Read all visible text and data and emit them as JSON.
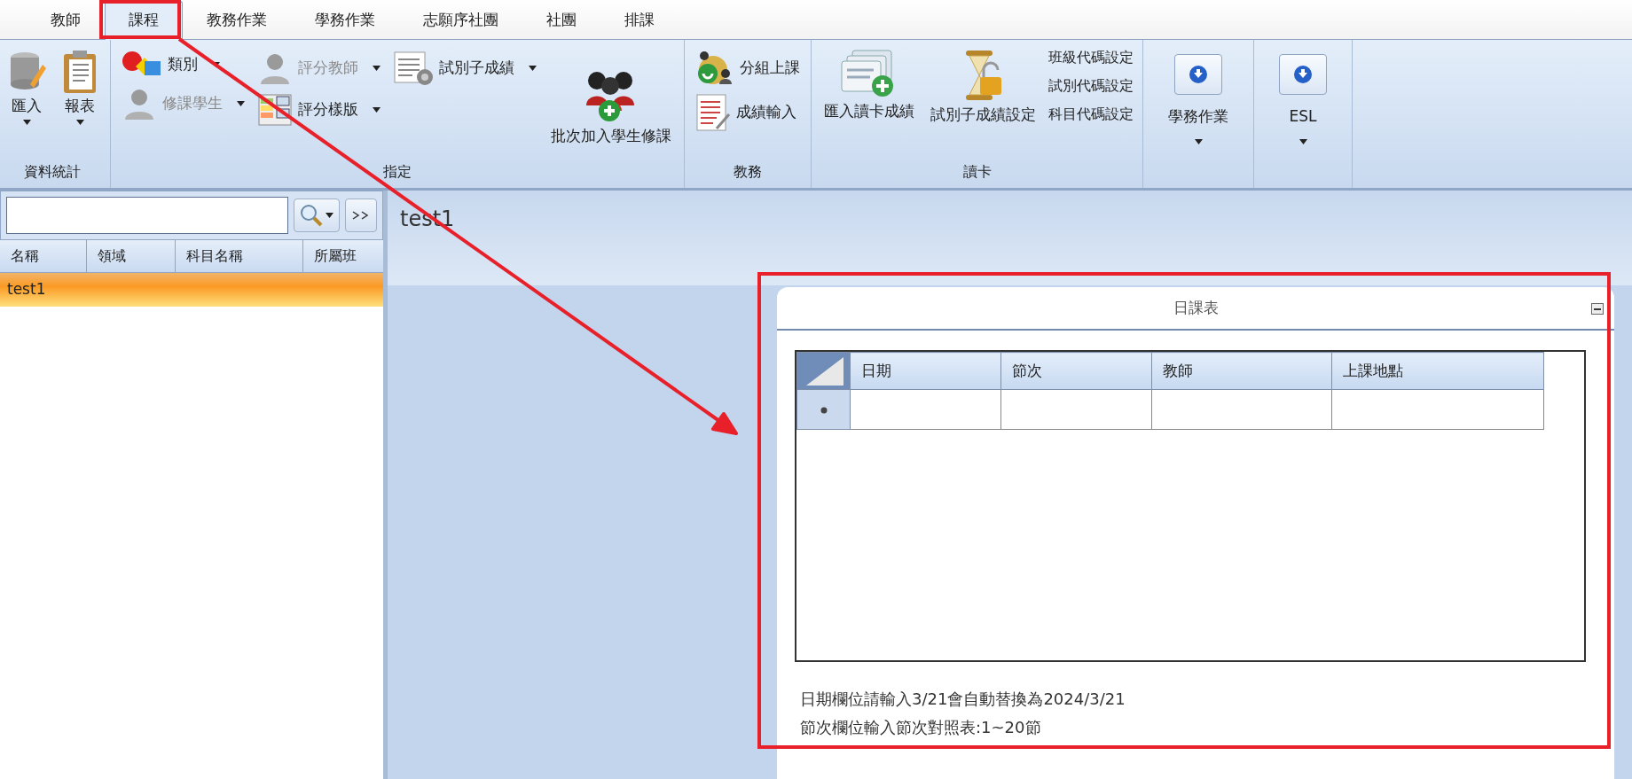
{
  "tabs": [
    {
      "label": "教師",
      "selected": false
    },
    {
      "label": "課程",
      "selected": true
    },
    {
      "label": "教務作業",
      "selected": false
    },
    {
      "label": "學務作業",
      "selected": false
    },
    {
      "label": "志願序社團",
      "selected": false
    },
    {
      "label": "社團",
      "selected": false
    },
    {
      "label": "排課",
      "selected": false
    }
  ],
  "ribbon": {
    "groups": [
      {
        "label": "資料統計",
        "columns": [
          {
            "items": [
              {
                "kind": "large",
                "label": "匯入",
                "dropdown": true,
                "disabled": false
              }
            ]
          },
          {
            "items": [
              {
                "kind": "large",
                "label": "報表",
                "dropdown": true,
                "disabled": false
              }
            ]
          }
        ]
      },
      {
        "label": "指定",
        "columns": [
          {
            "items": [
              {
                "kind": "small",
                "label": "類別",
                "dropdown": true,
                "disabled": false
              },
              {
                "kind": "small",
                "label": "修課學生",
                "dropdown": true,
                "disabled": true
              }
            ]
          },
          {
            "items": [
              {
                "kind": "small",
                "label": "評分教師",
                "dropdown": true,
                "disabled": true
              },
              {
                "kind": "small",
                "label": "評分樣版",
                "dropdown": true,
                "disabled": false
              }
            ]
          },
          {
            "items": [
              {
                "kind": "small",
                "label": "試別子成績",
                "dropdown": true,
                "disabled": false
              }
            ]
          },
          {
            "items": [
              {
                "kind": "large",
                "label": "批次加入學生修課",
                "dropdown": false,
                "disabled": false
              }
            ]
          }
        ]
      },
      {
        "label": "教務",
        "columns": [
          {
            "items": [
              {
                "kind": "small",
                "label": "分組上課",
                "dropdown": false,
                "disabled": false
              },
              {
                "kind": "small",
                "label": "成績輸入",
                "dropdown": false,
                "disabled": false
              }
            ]
          }
        ]
      },
      {
        "label": "讀卡",
        "columns": [
          {
            "items": [
              {
                "kind": "large",
                "label": "匯入讀卡成績",
                "dropdown": false,
                "disabled": false
              }
            ]
          },
          {
            "items": [
              {
                "kind": "large",
                "label": "試別子成績設定",
                "dropdown": false,
                "disabled": false
              }
            ]
          },
          {
            "items": [
              {
                "kind": "text",
                "label": "班級代碼設定",
                "dropdown": false,
                "disabled": false
              },
              {
                "kind": "text",
                "label": "試別代碼設定",
                "dropdown": false,
                "disabled": false
              },
              {
                "kind": "text",
                "label": "科目代碼設定",
                "dropdown": false,
                "disabled": false
              }
            ]
          }
        ]
      },
      {
        "columns": [
          {
            "items": [
              {
                "kind": "menu",
                "label": "學務作業",
                "dropdown": true,
                "disabled": false
              }
            ]
          }
        ]
      },
      {
        "columns": [
          {
            "items": [
              {
                "kind": "menu",
                "label": "ESL",
                "dropdown": true,
                "disabled": false
              }
            ]
          }
        ]
      }
    ]
  },
  "list_panel": {
    "columns": [
      "名稱",
      "領域",
      "科目名稱",
      "所屬班"
    ],
    "rows": [
      {
        "name": "test1",
        "selected": true
      }
    ]
  },
  "detail": {
    "title": "test1",
    "card": {
      "title": "日課表",
      "grid": {
        "columns": [
          "日期",
          "節次",
          "教師",
          "上課地點"
        ]
      },
      "notes": [
        "日期欄位請輸入3/21會自動替換為2024/3/21",
        "節次欄位輸入節次對照表:1~20節"
      ]
    }
  }
}
